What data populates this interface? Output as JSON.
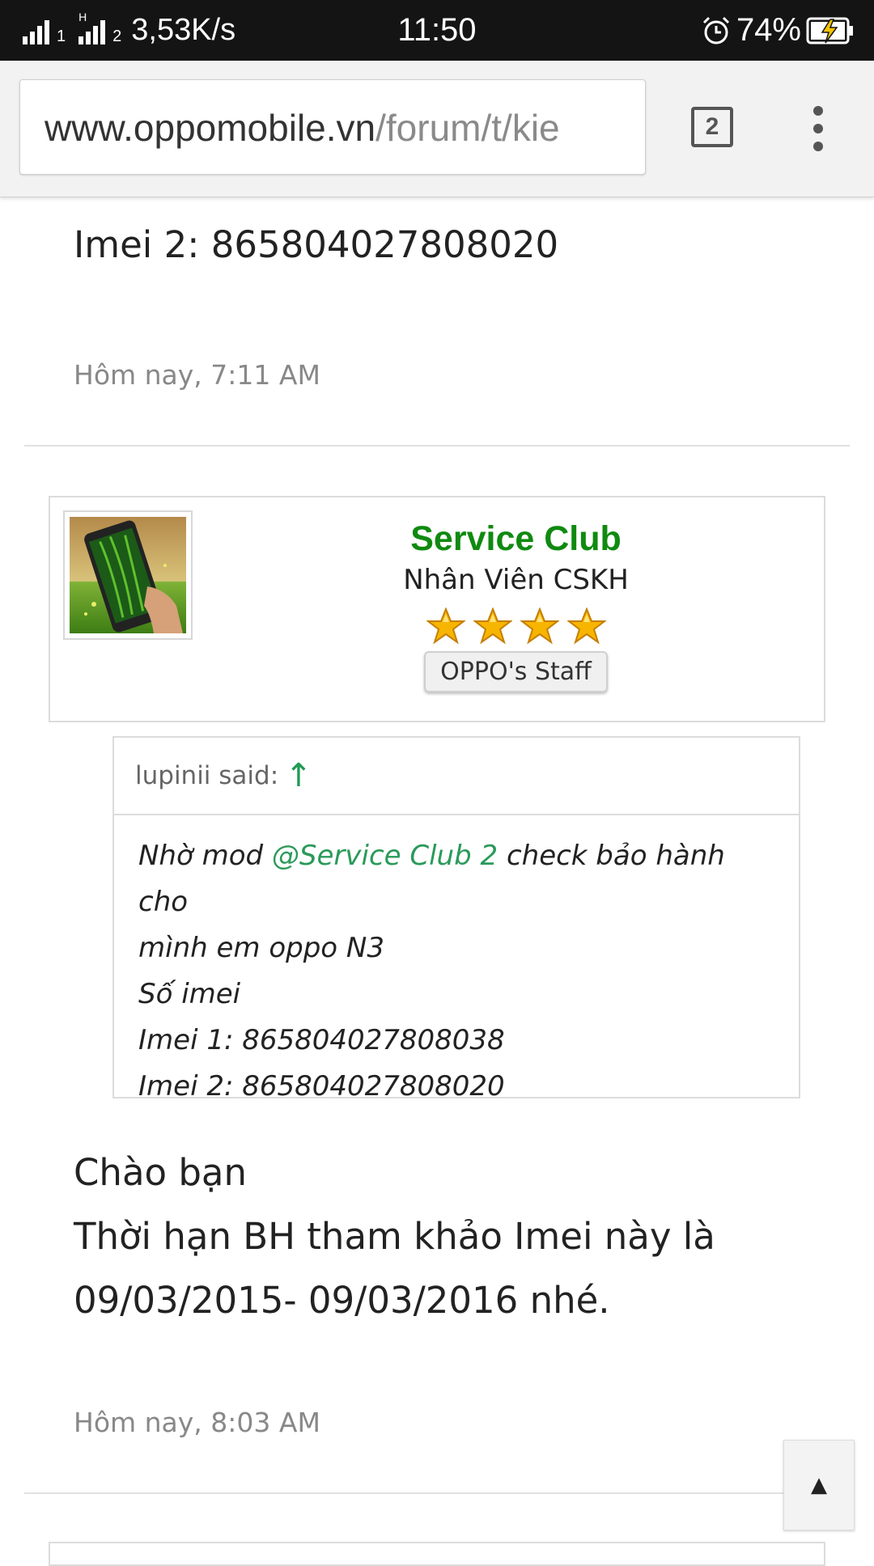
{
  "status_bar": {
    "network_speed": "3,53K/s",
    "sim1_label": "1",
    "sim2_label": "2",
    "sim2_type": "H",
    "time": "11:50",
    "battery_percent": "74%"
  },
  "browser": {
    "url_host": "www.oppomobile.vn",
    "url_path": "/forum/t/kie",
    "tab_count": "2"
  },
  "post_prev": {
    "imei_line": "Imei 2: 865804027808020",
    "timestamp": "Hôm nay, 7:11 AM"
  },
  "user_card": {
    "name": "Service Club",
    "title": "Nhân Viên CSKH",
    "star_count": 4,
    "badge": "OPPO's Staff"
  },
  "quote": {
    "header": "lupinii said:",
    "arrow": "↑",
    "lines": [
      {
        "pre": "Nhờ mod ",
        "mention": "@Service Club 2",
        "post": " check bảo hành cho"
      },
      "mình em oppo N3",
      "Số imei",
      "Imei 1: 865804027808038",
      "Imei 2: 865804027808020"
    ]
  },
  "reply": {
    "greeting": "Chào bạn",
    "line1": "Thời hạn BH tham khảo Imei này là",
    "line2": "09/03/2015- 09/03/2016 nhé.",
    "timestamp": "Hôm nay, 8:03 AM"
  },
  "scroll_top_button": "▲",
  "colors": {
    "username": "#108a10",
    "mention": "#2a9a5a",
    "status_bar_bg": "#141414"
  }
}
